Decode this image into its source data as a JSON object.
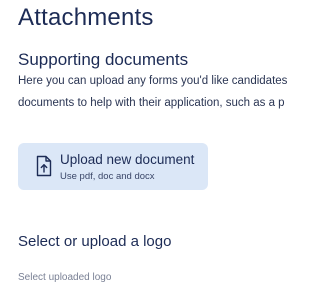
{
  "page": {
    "title": "Attachments"
  },
  "supporting": {
    "heading": "Supporting documents",
    "description_line1": "Here you can upload any forms you'd like candidates",
    "description_line2": "documents to help with their application, such as a p"
  },
  "upload": {
    "title": "Upload new document",
    "subtitle": "Use pdf, doc and docx",
    "icon": "file-upload-icon"
  },
  "logo": {
    "heading": "Select or upload a logo",
    "select_label": "Select uploaded logo"
  },
  "colors": {
    "heading": "#1c2b55",
    "upload_bg": "#dbe7f7",
    "muted": "#7a8195"
  }
}
